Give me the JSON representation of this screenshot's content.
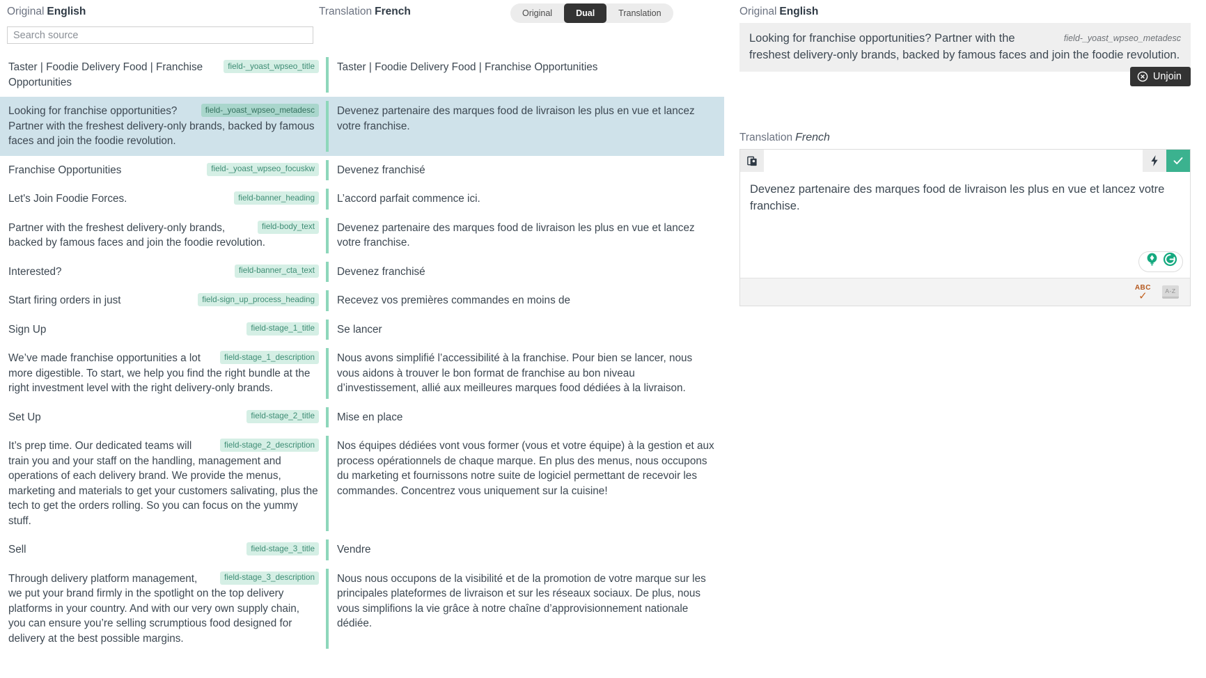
{
  "header": {
    "original_label": "Original",
    "original_lang": "English",
    "translation_label": "Translation",
    "translation_lang": "French",
    "mode_original": "Original",
    "mode_dual": "Dual",
    "mode_translation": "Translation",
    "active_mode": "Dual"
  },
  "search": {
    "value": "",
    "placeholder": "Search source"
  },
  "segments": [
    {
      "field": "field-_yoast_wpseo_title",
      "source": "Taster | Foodie Delivery Food | Franchise Opportunities",
      "target": "Taster | Foodie Delivery Food | Franchise Opportunities",
      "selected": false
    },
    {
      "field": "field-_yoast_wpseo_metadesc",
      "source": "Looking for franchise opportunities? Partner with the freshest delivery-only brands, backed by famous faces and join the foodie revolution.",
      "target": "Devenez partenaire des marques food de livraison les plus en vue et lancez votre franchise.",
      "selected": true
    },
    {
      "field": "field-_yoast_wpseo_focuskw",
      "source": "Franchise Opportunities",
      "target": "Devenez franchisé",
      "selected": false
    },
    {
      "field": "field-banner_heading",
      "source": "Let's Join Foodie Forces.",
      "target": "L’accord parfait commence ici.",
      "selected": false
    },
    {
      "field": "field-body_text",
      "source": "Partner with the freshest delivery-only brands, backed by famous faces and join the foodie revolution.",
      "target": "Devenez partenaire des marques food de livraison les plus en vue et lancez votre franchise.",
      "selected": false
    },
    {
      "field": "field-banner_cta_text",
      "source": "Interested?",
      "target": "Devenez franchisé",
      "selected": false
    },
    {
      "field": "field-sign_up_process_heading",
      "source": "Start firing orders in just",
      "target": "Recevez vos premières commandes en moins de",
      "selected": false
    },
    {
      "field": "field-stage_1_title",
      "source": "Sign Up",
      "target": "Se lancer",
      "selected": false
    },
    {
      "field": "field-stage_1_description",
      "source": "We’ve made franchise opportunities a lot more digestible. To start, we help you find the right bundle at the right investment level with the right delivery-only brands.",
      "target": "Nous avons simplifié l’accessibilité à la franchise. Pour bien se lancer, nous vous aidons à trouver le bon format de franchise au bon niveau d’investissement, allié aux meilleures marques food dédiées à la livraison.",
      "selected": false
    },
    {
      "field": "field-stage_2_title",
      "source": "Set Up",
      "target": "Mise en place",
      "selected": false
    },
    {
      "field": "field-stage_2_description",
      "source": "It’s prep time. Our dedicated teams will train you and your staff on the handling, management and operations of each delivery brand. We provide the menus, marketing and materials to get your customers salivating, plus the tech to get the orders rolling. So you can focus on the yummy stuff.",
      "target": "Nos équipes dédiées vont vous former (vous et votre équipe) à la gestion et aux process opérationnels de chaque marque. En plus des menus, nous occupons du marketing et fournissons notre suite de logiciel permettant de recevoir les commandes. Concentrez vous uniquement sur la cuisine!",
      "selected": false
    },
    {
      "field": "field-stage_3_title",
      "source": "Sell",
      "target": "Vendre",
      "selected": false
    },
    {
      "field": "field-stage_3_description",
      "source": "Through delivery platform management, we put your brand firmly in the spotlight on the top delivery platforms in your country. And with our very own supply chain, you can ensure you’re selling scrumptious food designed for delivery at the best possible margins.",
      "target": "Nous nous occupons de la visibilité et de la promotion de votre marque sur les principales plateformes de livraison et sur les réseaux sociaux. De plus, nous vous simplifions la vie grâce à notre chaîne d’approvisionnement nationale dédiée.",
      "selected": false
    }
  ],
  "inspector": {
    "original_label": "Original",
    "original_lang": "English",
    "original_text": "Looking for franchise opportunities? Partner with the freshest delivery-only brands, backed by famous faces and join the foodie revolution.",
    "original_field": "field-_yoast_wpseo_metadesc",
    "unjoin_label": "Unjoin",
    "translation_label": "Translation",
    "translation_lang": "French",
    "translation_text": "Devenez partenaire des marques food de livraison les plus en vue et lancez votre franchise.",
    "abc_label": "ABC",
    "dict_label": "A-Z"
  },
  "colors": {
    "accent_green": "#3bb28f",
    "divider_green": "#8ed7bb",
    "tag_bg": "#d5efe5",
    "tag_text": "#3f8d75",
    "selected_row": "#cfe2ea",
    "dark_button": "#333333"
  }
}
